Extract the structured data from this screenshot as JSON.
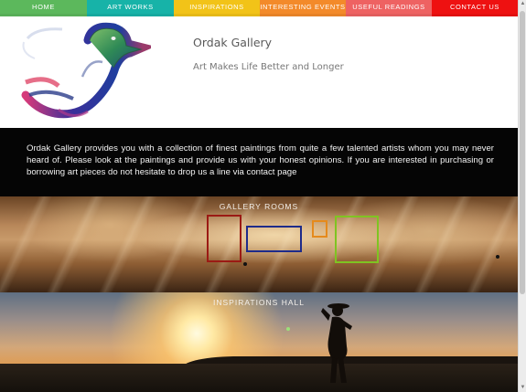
{
  "nav": {
    "items": [
      {
        "label": "HOME"
      },
      {
        "label": "ART WORKS"
      },
      {
        "label": "INSPIRATIONS"
      },
      {
        "label": "INTERESTING EVENTS"
      },
      {
        "label": "USEFUL READINGS"
      },
      {
        "label": "CONTACT US"
      }
    ]
  },
  "header": {
    "title": "Ordak Gallery",
    "tagline": "Art Makes Life Better and Longer"
  },
  "intro": {
    "text": "Ordak Gallery provides you with a collection of finest paintings from quite a few talented artists whom you may never heard of. Please look at the paintings and provide us with your honest opinions. If you are interested in purchasing or borrowing art pieces do not hesitate to drop us a line via ",
    "link": "contact page"
  },
  "sections": {
    "gallery_rooms": "GALLERY ROOMS",
    "inspirations_hall": "INSPIRATIONS HALL"
  },
  "colors": {
    "nav_home": "#5cb85c",
    "nav_art_works": "#17b3a8",
    "nav_inspirations": "#f2c318",
    "nav_events": "#f38a2a",
    "nav_readings": "#ee6262",
    "nav_contact": "#ee1111",
    "frame_red": "#9b1a14",
    "frame_blue": "#1e2b8a",
    "frame_orange": "#e58a1c",
    "frame_green": "#7fc422"
  },
  "icons": {
    "logo": "duck-logo-icon",
    "scroll_up": "triangle-up-icon",
    "scroll_down": "triangle-down-icon"
  }
}
